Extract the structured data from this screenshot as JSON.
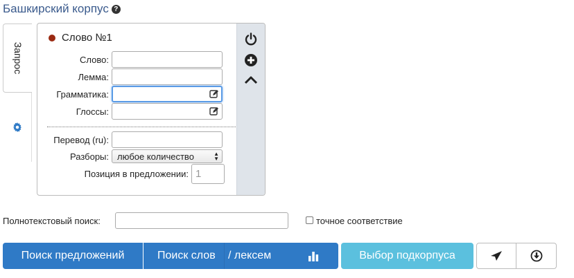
{
  "header": {
    "title": "Башкирский корпус",
    "help_icon": "question-circle-icon"
  },
  "tabs": [
    {
      "label": "Запрос",
      "active": true
    },
    {
      "label": "",
      "icon": "gear-icon"
    }
  ],
  "word_panel": {
    "title": "Слово №1",
    "status_color": "#9a2a12",
    "fields": {
      "word": {
        "label": "Слово:",
        "value": ""
      },
      "lemma": {
        "label": "Лемма:",
        "value": ""
      },
      "grammar": {
        "label": "Грамматика:",
        "value": ""
      },
      "glosses": {
        "label": "Глоссы:",
        "value": ""
      },
      "translation": {
        "label": "Перевод (ru):",
        "value": ""
      },
      "analyses": {
        "label": "Разборы:",
        "selected": "любое количество"
      },
      "position": {
        "label": "Позиция в предложении:",
        "placeholder": "1"
      }
    },
    "side_controls": [
      "power-icon",
      "plus-circle-icon",
      "chevron-up-icon"
    ]
  },
  "fulltext": {
    "label": "Полнотекстовый поиск:",
    "value": "",
    "exact_label": "точное соответствие",
    "exact_checked": false
  },
  "buttons": {
    "search_sentences": "Поиск предложений",
    "search_words": "Поиск слов",
    "search_lexemes": "/ лексем",
    "select_subcorpus": "Выбор подкорпуса"
  },
  "colors": {
    "primary": "#2f7ac6",
    "info": "#5bc0de",
    "title": "#3a5a8c"
  }
}
